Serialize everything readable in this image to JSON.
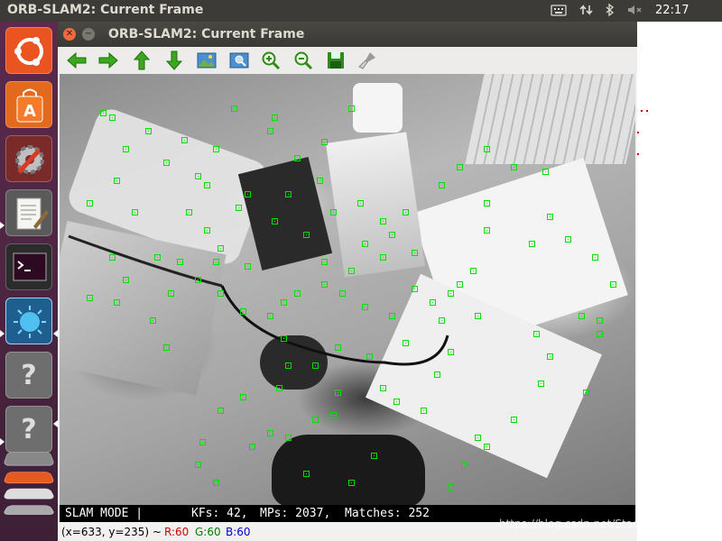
{
  "top_panel": {
    "app_title": "ORB-SLAM2: Current Frame",
    "clock": "22:17",
    "indicators": [
      "keyboard-icon",
      "network-icon",
      "bluetooth-icon",
      "volume-muted-icon"
    ]
  },
  "launcher": {
    "items": [
      {
        "name": "ubuntu-dash-icon",
        "color": "#e95420"
      },
      {
        "name": "software-center-icon",
        "color": "#e2691d"
      },
      {
        "name": "system-settings-icon",
        "color": "#c23a2a"
      },
      {
        "name": "text-editor-icon",
        "color": "#e8e6e0"
      },
      {
        "name": "terminal-icon",
        "color": "#2c2c2c"
      },
      {
        "name": "orbslam-app-icon",
        "color": "#3fa3d8"
      },
      {
        "name": "unknown-app-icon",
        "glyph": "?"
      },
      {
        "name": "unknown-app-icon",
        "glyph": "?"
      }
    ]
  },
  "window": {
    "title": "ORB-SLAM2: Current Frame",
    "toolbar": [
      "arrow-left-icon",
      "arrow-right-icon",
      "arrow-up-icon",
      "arrow-down-icon",
      "image-icon",
      "image-zoom-icon",
      "zoom-in-icon",
      "zoom-out-icon",
      "save-icon",
      "brush-icon"
    ],
    "status": {
      "mode": "SLAM MODE |",
      "kfs": "KFs: 42,",
      "mps": "MPs: 2037,",
      "matches": "Matches: 252"
    },
    "coords": {
      "prefix": "(x=633, y=235) ~",
      "r": "R:60",
      "g": "G:60",
      "b": "B:60"
    }
  },
  "colors": {
    "keypoint": "#00e000",
    "panel_bg": "#3c3b37",
    "launcher_bg": "#4a2440"
  },
  "watermark": "https://blog.csdn.net/Stackingrule"
}
